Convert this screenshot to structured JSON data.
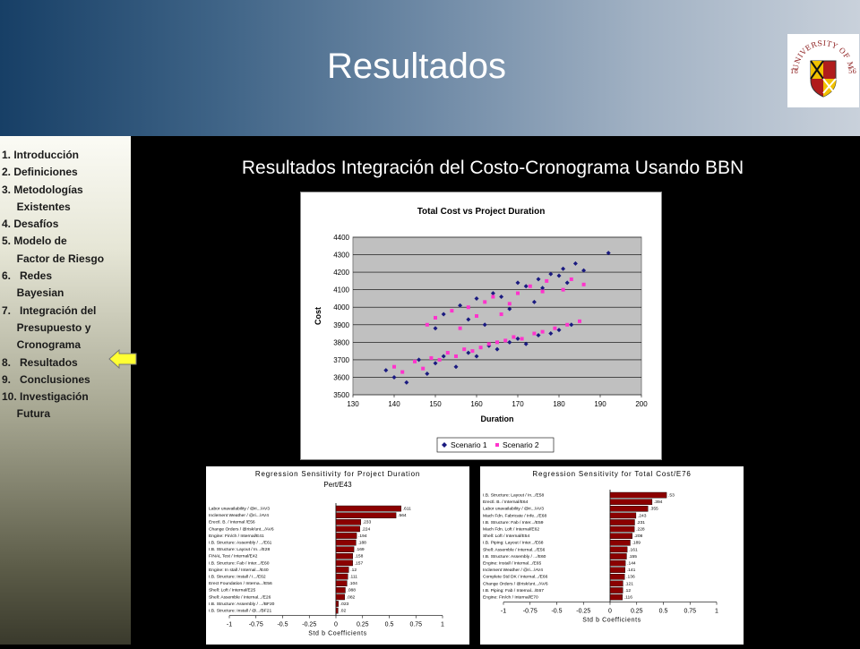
{
  "slide": {
    "title": "Resultados",
    "subtitle": "Resultados Integración del Costo-Cronograma Usando BBN",
    "logo": {
      "ring_text": "UNIVERSITY OF MARYLAND",
      "year_left": "18",
      "year_right": "56"
    }
  },
  "sidebar": {
    "items": [
      {
        "label": "1. Introducción"
      },
      {
        "label": "2. Definiciones"
      },
      {
        "label": "3. Metodologías"
      },
      {
        "label": "     Existentes"
      },
      {
        "label": "4. Desafíos"
      },
      {
        "label": "5. Modelo de"
      },
      {
        "label": "     Factor de Riesgo"
      },
      {
        "label": "6.   Redes"
      },
      {
        "label": "     Bayesian"
      },
      {
        "label": "7.   Integración del"
      },
      {
        "label": "     Presupuesto y"
      },
      {
        "label": "     Cronograma"
      },
      {
        "label": "8.   Resultados"
      },
      {
        "label": "9.   Conclusiones"
      },
      {
        "label": "10. Investigación"
      },
      {
        "label": "     Futura"
      }
    ],
    "current_marker_item": 12,
    "arrow_color": "#ffff33"
  },
  "chart_data": [
    {
      "type": "scatter",
      "title": "Total Cost vs Project Duration",
      "xlabel": "Duration",
      "ylabel": "Cost",
      "xlim": [
        130,
        200
      ],
      "ylim": [
        3500,
        4400
      ],
      "xticks": [
        130,
        140,
        150,
        160,
        170,
        180,
        190,
        200
      ],
      "yticks": [
        3500,
        3600,
        3700,
        3800,
        3900,
        4000,
        4100,
        4200,
        4300,
        4400
      ],
      "grid": true,
      "legend_position": "bottom",
      "plot_background": "#c0c0c0",
      "series": [
        {
          "name": "Scenario 1",
          "color": "#1a1a80",
          "marker": "diamond",
          "values": [
            [
              138,
              3640
            ],
            [
              140,
              3600
            ],
            [
              143,
              3570
            ],
            [
              146,
              3700
            ],
            [
              148,
              3620
            ],
            [
              150,
              3680
            ],
            [
              152,
              3720
            ],
            [
              155,
              3660
            ],
            [
              158,
              3740
            ],
            [
              160,
              3720
            ],
            [
              163,
              3780
            ],
            [
              165,
              3760
            ],
            [
              168,
              3800
            ],
            [
              170,
              3820
            ],
            [
              172,
              3790
            ],
            [
              175,
              3840
            ],
            [
              178,
              3850
            ],
            [
              180,
              3870
            ],
            [
              183,
              3900
            ],
            [
              152,
              3960
            ],
            [
              156,
              4010
            ],
            [
              160,
              4050
            ],
            [
              164,
              4080
            ],
            [
              168,
              3990
            ],
            [
              172,
              4120
            ],
            [
              175,
              4160
            ],
            [
              178,
              4190
            ],
            [
              181,
              4220
            ],
            [
              184,
              4250
            ],
            [
              186,
              4210
            ],
            [
              192,
              4310
            ],
            [
              150,
              3880
            ],
            [
              158,
              3930
            ],
            [
              162,
              3900
            ],
            [
              166,
              4060
            ],
            [
              170,
              4140
            ],
            [
              174,
              4030
            ],
            [
              176,
              4110
            ],
            [
              180,
              4180
            ],
            [
              182,
              4140
            ]
          ]
        },
        {
          "name": "Scenario 2",
          "color": "#ff33cc",
          "marker": "square",
          "values": [
            [
              140,
              3660
            ],
            [
              142,
              3630
            ],
            [
              145,
              3690
            ],
            [
              147,
              3650
            ],
            [
              149,
              3710
            ],
            [
              151,
              3700
            ],
            [
              153,
              3740
            ],
            [
              155,
              3720
            ],
            [
              157,
              3760
            ],
            [
              159,
              3750
            ],
            [
              161,
              3770
            ],
            [
              163,
              3790
            ],
            [
              165,
              3800
            ],
            [
              167,
              3810
            ],
            [
              169,
              3830
            ],
            [
              171,
              3820
            ],
            [
              174,
              3850
            ],
            [
              176,
              3860
            ],
            [
              179,
              3880
            ],
            [
              182,
              3900
            ],
            [
              185,
              3920
            ],
            [
              150,
              3940
            ],
            [
              154,
              3980
            ],
            [
              158,
              4000
            ],
            [
              162,
              4030
            ],
            [
              166,
              3960
            ],
            [
              170,
              4080
            ],
            [
              173,
              4120
            ],
            [
              177,
              4150
            ],
            [
              181,
              4100
            ],
            [
              183,
              4160
            ],
            [
              186,
              4130
            ],
            [
              148,
              3900
            ],
            [
              156,
              3880
            ],
            [
              164,
              4060
            ],
            [
              168,
              4020
            ],
            [
              176,
              4090
            ],
            [
              160,
              3950
            ]
          ]
        }
      ]
    },
    {
      "type": "bar",
      "orientation": "horizontal",
      "title": "Regression Sensitivity for Project Duration",
      "subtitle": "Pert/E43",
      "xlabel": "Std b Coefficients",
      "xlim": [
        -1,
        1
      ],
      "xticks": [
        "-1",
        "-0.75",
        "-0.5",
        "-0.25",
        "0",
        "0.25",
        "0.5",
        "0.75",
        "1"
      ],
      "bar_color": "#8b0000",
      "categories": [
        "Labor unavailability / @ri.../AV3",
        "Inclement Weather / @ri.../AV4",
        "Erectl. B. / Internal /E56",
        "Change Orders / @risk/unt.../AV6",
        "Engine: Fin/ch / Internal/E41",
        "I.B. Structure: Assembly / .../E61",
        "I.B. Structure: Layout / In.../E28",
        "FINAL Test / Internal/E42",
        "I.B. Structure: Fab / Inter.../E60",
        "Engine: In stall / Internal.../E40",
        "I.B. Structure: Install / I.../E62",
        "Erect Foundation / Interna.../E56",
        "Shell: Loft / Internal/E25",
        "Shell: Assemble / Internal.../E26",
        "I.B. Structure: Assembly / .../BF20",
        "I.B. Structure: Install / @.../BF21"
      ],
      "values": [
        0.611,
        0.564,
        0.233,
        0.224,
        0.194,
        0.188,
        0.169,
        0.158,
        0.157,
        0.12,
        0.111,
        0.104,
        0.088,
        0.082,
        0.023,
        0.02
      ],
      "value_labels": [
        ".611",
        ".564",
        ".233",
        ".224",
        ".194",
        ".188",
        ".169",
        ".158",
        ".157",
        ".12",
        ".111",
        ".104",
        ".088",
        ".082",
        ".023",
        ".02"
      ]
    },
    {
      "type": "bar",
      "orientation": "horizontal",
      "title": "Regression Sensitivity for Total Cost/E76",
      "xlabel": "Std b Coefficients",
      "xlim": [
        -1,
        1
      ],
      "xticks": [
        "-1",
        "-0.75",
        "-0.5",
        "-0.25",
        "0",
        "0.25",
        "0.5",
        "0.75",
        "1"
      ],
      "bar_color": "#8b0000",
      "categories": [
        "I.B. Structure: Layout / In.../E58",
        "Erectl. B. / Internal/E64",
        "Labor unavailability / @ri.../AV3",
        "Mach Fdn. Fabricate / Infe.../E68",
        "I.B. Structure: Fab / Inter.../E59",
        "Mach Fdn. Loft / Internal/E62",
        "Shell: Loft / Internal/E54",
        "I.B. Piping: Layout / Inter.../E68",
        "Shell: Assemble / Internal.../E56",
        "I.B. Structure: Assembly / .../E60",
        "Engine: Install / Internal.../E65",
        "Inclement Weather / @ri.../AV4",
        "Complete Std DK / Internal.../E66",
        "Change Orders / @risk/unt.../AV6",
        "I.B. Piping: Fab / Internal.../E67",
        "Engine: Fin/ch / Internal/E70"
      ],
      "values": [
        0.53,
        0.394,
        0.355,
        0.243,
        0.231,
        0.228,
        0.208,
        0.189,
        0.161,
        0.155,
        0.144,
        0.141,
        0.136,
        0.121,
        0.12,
        0.116
      ],
      "value_labels": [
        ".53",
        ".394",
        ".355",
        ".243",
        ".231",
        ".228",
        ".208",
        ".189",
        ".161",
        ".155",
        ".144",
        ".141",
        ".136",
        ".121",
        ".12",
        ".116"
      ]
    }
  ]
}
